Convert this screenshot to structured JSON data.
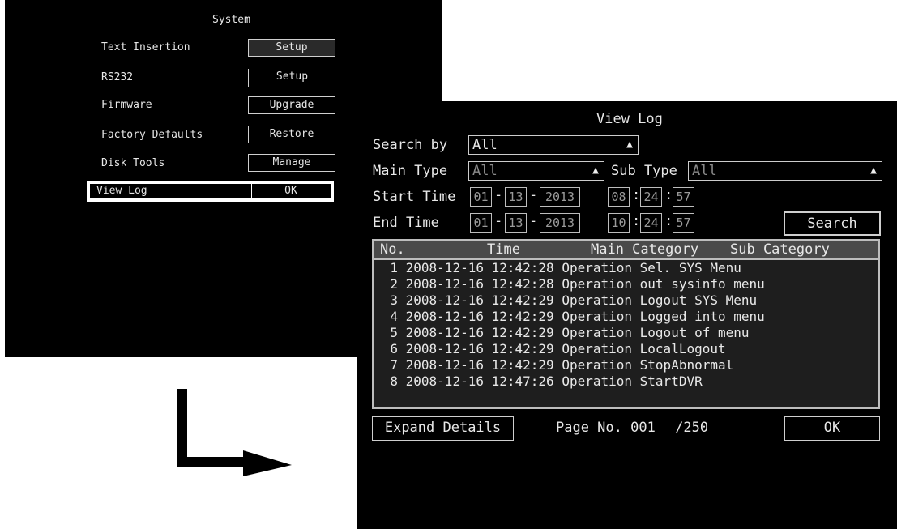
{
  "system_menu": {
    "title": "System",
    "items": [
      {
        "label": "Text Insertion",
        "button": "Setup"
      },
      {
        "label": "RS232",
        "button": "Setup"
      },
      {
        "label": "Firmware",
        "button": "Upgrade"
      },
      {
        "label": "Factory Defaults",
        "button": "Restore"
      },
      {
        "label": "Disk Tools",
        "button": "Manage"
      },
      {
        "label": "View Log",
        "button": "OK"
      }
    ]
  },
  "view_log": {
    "title": "View Log",
    "search_by_label": "Search by",
    "search_by_value": "All",
    "main_type_label": "Main Type",
    "main_type_value": "All",
    "sub_type_label": "Sub Type",
    "sub_type_value": "All",
    "start_time_label": "Start Time",
    "start_date": {
      "month": "01",
      "day": "13",
      "year": "2013"
    },
    "start_clock": {
      "h": "08",
      "m": "24",
      "s": "57"
    },
    "end_time_label": "End Time",
    "end_date": {
      "month": "01",
      "day": "13",
      "year": "2013"
    },
    "end_clock": {
      "h": "10",
      "m": "24",
      "s": "57"
    },
    "search_button": "Search",
    "columns": {
      "no": "No.",
      "time": "Time",
      "main": "Main Category",
      "sub": "Sub Category"
    },
    "rows": [
      {
        "no": "1",
        "time": "2008-12-16 12:42:28",
        "main": "Operation",
        "sub": "Sel. SYS Menu"
      },
      {
        "no": "2",
        "time": "2008-12-16 12:42:28",
        "main": "Operation",
        "sub": "out sysinfo menu"
      },
      {
        "no": "3",
        "time": "2008-12-16 12:42:29",
        "main": "Operation",
        "sub": "Logout SYS Menu"
      },
      {
        "no": "4",
        "time": "2008-12-16 12:42:29",
        "main": "Operation",
        "sub": "Logged into menu"
      },
      {
        "no": "5",
        "time": "2008-12-16 12:42:29",
        "main": "Operation",
        "sub": "Logout of menu"
      },
      {
        "no": "6",
        "time": "2008-12-16 12:42:29",
        "main": "Operation",
        "sub": "LocalLogout"
      },
      {
        "no": "7",
        "time": "2008-12-16 12:42:29",
        "main": "Operation",
        "sub": "StopAbnormal"
      },
      {
        "no": "8",
        "time": "2008-12-16 12:47:26",
        "main": "Operation",
        "sub": "StartDVR"
      }
    ],
    "expand_button": "Expand Details",
    "page_label": "Page No.",
    "page_current": "001",
    "page_total": "/250",
    "ok_button": "OK"
  }
}
